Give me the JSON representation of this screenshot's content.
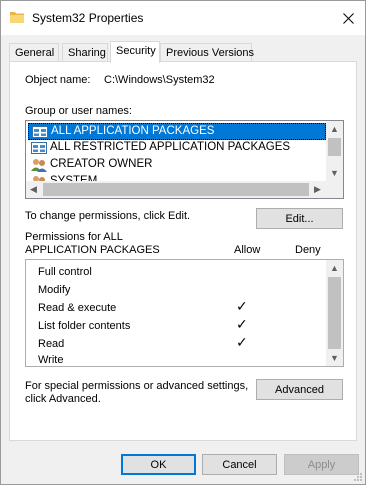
{
  "window": {
    "title": "System32 Properties"
  },
  "tabs": [
    {
      "label": "General"
    },
    {
      "label": "Sharing"
    },
    {
      "label": "Security"
    },
    {
      "label": "Previous Versions"
    }
  ],
  "security": {
    "object_name_label": "Object name:",
    "object_name_value": "C:\\Windows\\System32",
    "group_label": "Group or user names:",
    "groups": [
      {
        "label": "ALL APPLICATION PACKAGES",
        "icon": "app-packages-icon",
        "selected": true
      },
      {
        "label": "ALL RESTRICTED APPLICATION PACKAGES",
        "icon": "app-packages-icon",
        "selected": false
      },
      {
        "label": "CREATOR OWNER",
        "icon": "users-icon",
        "selected": false
      },
      {
        "label": "SYSTEM",
        "icon": "users-icon",
        "selected": false
      }
    ],
    "change_text": "To change permissions, click Edit.",
    "edit_label": "Edit...",
    "permissions_for_line1": "Permissions for ALL",
    "permissions_for_line2": "APPLICATION PACKAGES",
    "allow_header": "Allow",
    "deny_header": "Deny",
    "permissions": [
      {
        "label": "Full control",
        "allow": false,
        "deny": false
      },
      {
        "label": "Modify",
        "allow": false,
        "deny": false
      },
      {
        "label": "Read & execute",
        "allow": true,
        "deny": false
      },
      {
        "label": "List folder contents",
        "allow": true,
        "deny": false
      },
      {
        "label": "Read",
        "allow": true,
        "deny": false
      },
      {
        "label": "Write",
        "allow": false,
        "deny": false
      }
    ],
    "check_glyph": "✓",
    "special_line1": "For special permissions or advanced settings,",
    "special_line2": "click Advanced.",
    "advanced_label": "Advanced"
  },
  "footer": {
    "ok_label": "OK",
    "cancel_label": "Cancel",
    "apply_label": "Apply"
  },
  "colors": {
    "selection": "#0078d7",
    "default_button_border": "#0078d7",
    "dialog_background": "#f0f0f0"
  }
}
